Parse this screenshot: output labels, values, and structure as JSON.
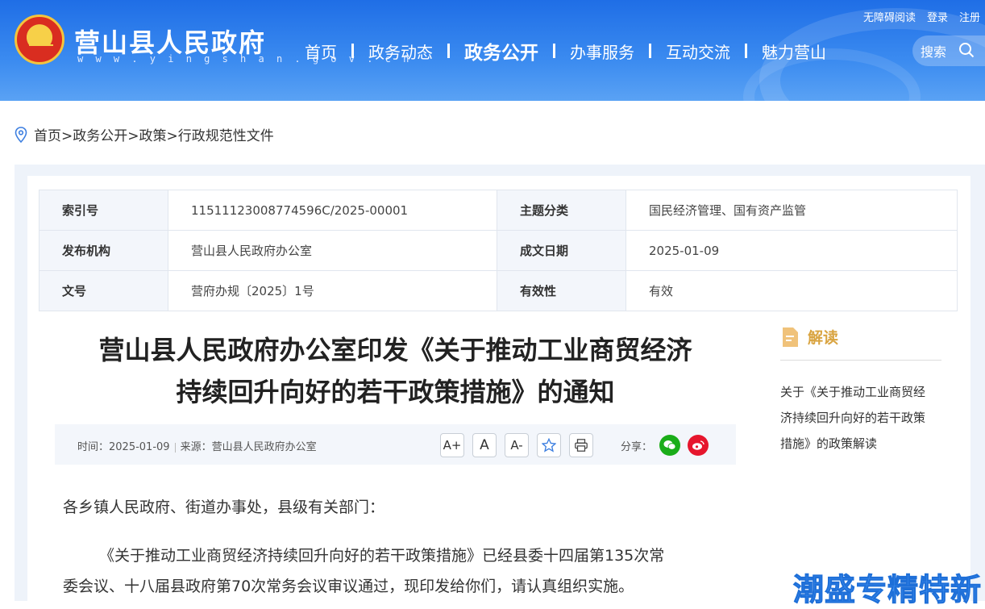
{
  "header": {
    "site_title": "营山县人民政府",
    "site_url": "w w w . y i n g s h a n . g o v . c n",
    "top_links": [
      "无障碍阅读",
      "登录",
      "注册"
    ],
    "nav": [
      "首页",
      "政务动态",
      "政务公开",
      "办事服务",
      "互动交流",
      "魅力营山"
    ],
    "active_nav": "政务公开",
    "search_label": "搜索"
  },
  "breadcrumb": "首页>政务公开>政策>行政规范性文件",
  "meta": {
    "rows": [
      {
        "k1": "索引号",
        "v1": "11511123008774596C/2025-00001",
        "k2": "主题分类",
        "v2": "国民经济管理、国有资产监管"
      },
      {
        "k1": "发布机构",
        "v1": "营山县人民政府办公室",
        "k2": "成文日期",
        "v2": "2025-01-09"
      },
      {
        "k1": "文号",
        "v1": "营府办规〔2025〕1号",
        "k2": "有效性",
        "v2": "有效"
      }
    ]
  },
  "article": {
    "title_line1": "营山县人民政府办公室印发《关于推动工业商贸经济",
    "title_line2": "持续回升向好的若干政策措施》的通知",
    "time": "时间：2025-01-09",
    "source": "来源：营山县人民政府办公室",
    "tools": [
      "A+",
      "A",
      "A-"
    ],
    "share_label": "分享：",
    "salutation": "各乡镇人民政府、街道办事处，县级有关部门：",
    "para1_line1": "《关于推动工业商贸经济持续回升向好的若干政策措施》已经县委十四届第135次常",
    "para1_line2": "委会议、十八届县政府第70次常务会议审议通过，现印发给你们，请认真组织实施。"
  },
  "side": {
    "heading": "解读",
    "link_line1": "关于《关于推动工业商贸经",
    "link_line2": "济持续回升向好的若干政策",
    "link_line3": "措施》的政策解读"
  },
  "watermark": "潮盛专精特新"
}
